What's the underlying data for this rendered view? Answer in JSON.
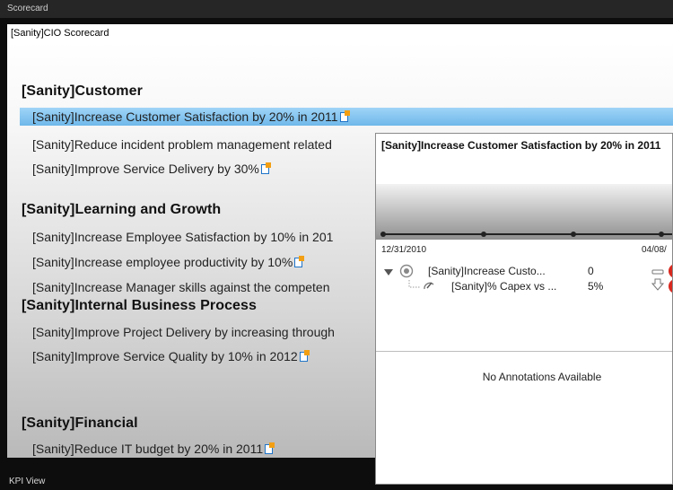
{
  "window": {
    "title": "Scorecard"
  },
  "scorecard": {
    "name": "[Sanity]CIO Scorecard"
  },
  "groups": [
    {
      "heading": "[Sanity]Customer",
      "items": [
        "[Sanity]Increase Customer Satisfaction by 20% in 2011",
        "[Sanity]Reduce incident problem management related",
        "[Sanity]Improve Service Delivery by 30%"
      ]
    },
    {
      "heading": "[Sanity]Learning and Growth",
      "items": [
        "[Sanity]Increase Employee Satisfaction by 10% in 201",
        "[Sanity]Increase employee productivity by 10%",
        "[Sanity]Increase Manager skills against the competen"
      ]
    },
    {
      "heading": "[Sanity]Internal Business Process",
      "items": [
        "[Sanity]Improve Project Delivery by increasing through",
        "[Sanity]Improve Service Quality by 10% in 2012"
      ]
    },
    {
      "heading": "[Sanity]Financial",
      "items": [
        "[Sanity]Reduce IT budget by 20% in 2011"
      ]
    }
  ],
  "popup": {
    "title": "[Sanity]Increase Customer Satisfaction by 20% in 2011",
    "date_start": "12/31/2010",
    "date_end": "04/08/",
    "kpis": [
      {
        "name": "[Sanity]Increase Custo...",
        "value": "0",
        "status_icon": "minus-icon"
      },
      {
        "name": "[Sanity]% Capex vs ...",
        "value": "5%",
        "status_icon": "arrow-down-icon"
      }
    ],
    "annotations": "No Annotations Available"
  },
  "bottom_bar": {
    "label": "KPI View"
  },
  "colors": {
    "selection": "#7fc3f0",
    "note_orange": "#f29f13",
    "note_blue": "#1f74c8",
    "status_red": "#d9281e"
  }
}
